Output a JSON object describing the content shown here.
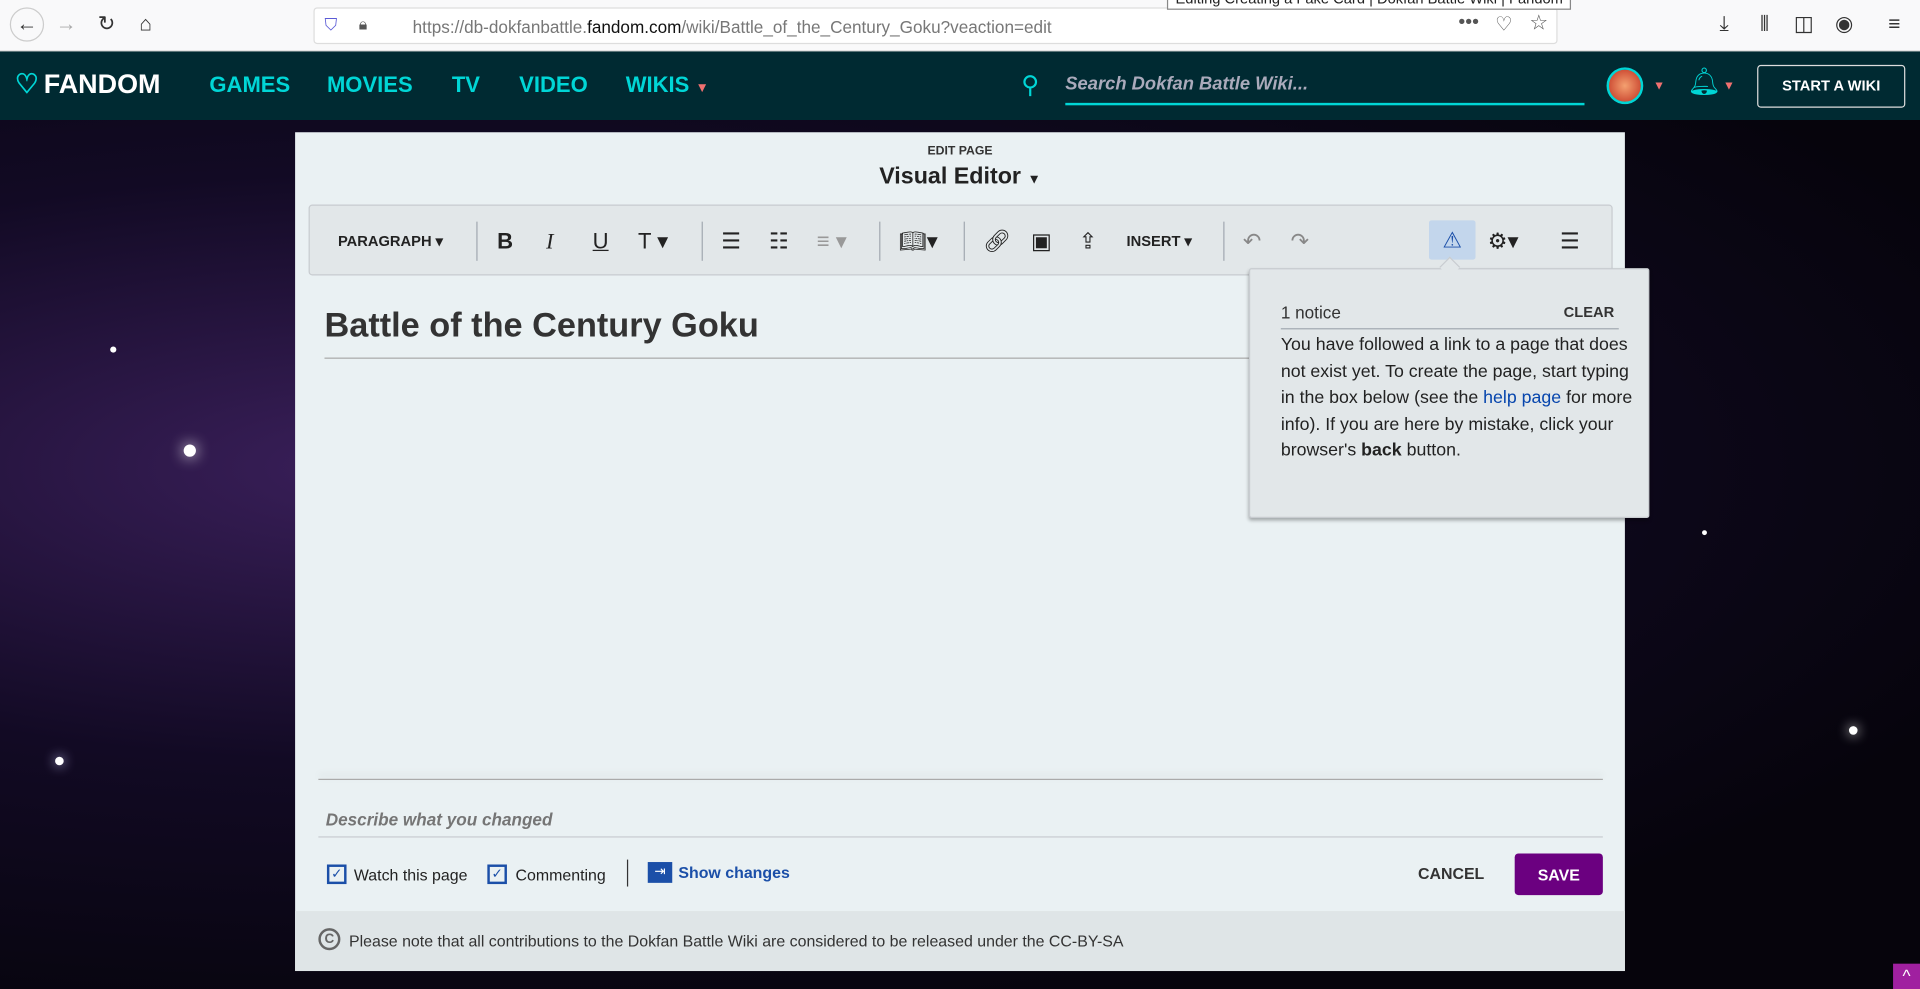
{
  "browser": {
    "url_prefix": "https://db-dokfanbattle.",
    "url_domain": "fandom.com",
    "url_path": "/wiki/Battle_of_the_Century_Goku?veaction=edit",
    "tooltip": "Editing Creating a Fake Card | Dokfan Battle Wiki | Fandom"
  },
  "nav": {
    "logo": "FANDOM",
    "links": [
      "GAMES",
      "MOVIES",
      "TV",
      "VIDEO",
      "WIKIS"
    ],
    "search_placeholder": "Search Dokfan Battle Wiki...",
    "start_wiki": "START A WIKI"
  },
  "editor": {
    "edit_page": "EDIT PAGE",
    "mode": "Visual Editor",
    "toolbar": {
      "paragraph": "PARAGRAPH",
      "insert": "INSERT"
    },
    "page_title": "Battle of the Century Goku",
    "summary_placeholder": "Describe what you changed",
    "watch": "Watch this page",
    "commenting": "Commenting",
    "show_changes": "Show changes",
    "cancel": "CANCEL",
    "save": "SAVE",
    "footer_note": "Please note that all contributions to the Dokfan Battle Wiki are considered to be released under the CC-BY-SA"
  },
  "notice": {
    "count": "1 notice",
    "clear": "CLEAR",
    "text_1": "You have followed a link to a page that does not exist yet. To create the page, start typing in the box below (see the ",
    "link": "help page",
    "text_2": " for more info). If you are here by mistake, click your browser's ",
    "bold": "back",
    "text_3": " button."
  },
  "colors": {
    "nav_bg": "#002a32",
    "accent": "#00d6d6",
    "save": "#6b0080",
    "link": "#0645ad"
  }
}
